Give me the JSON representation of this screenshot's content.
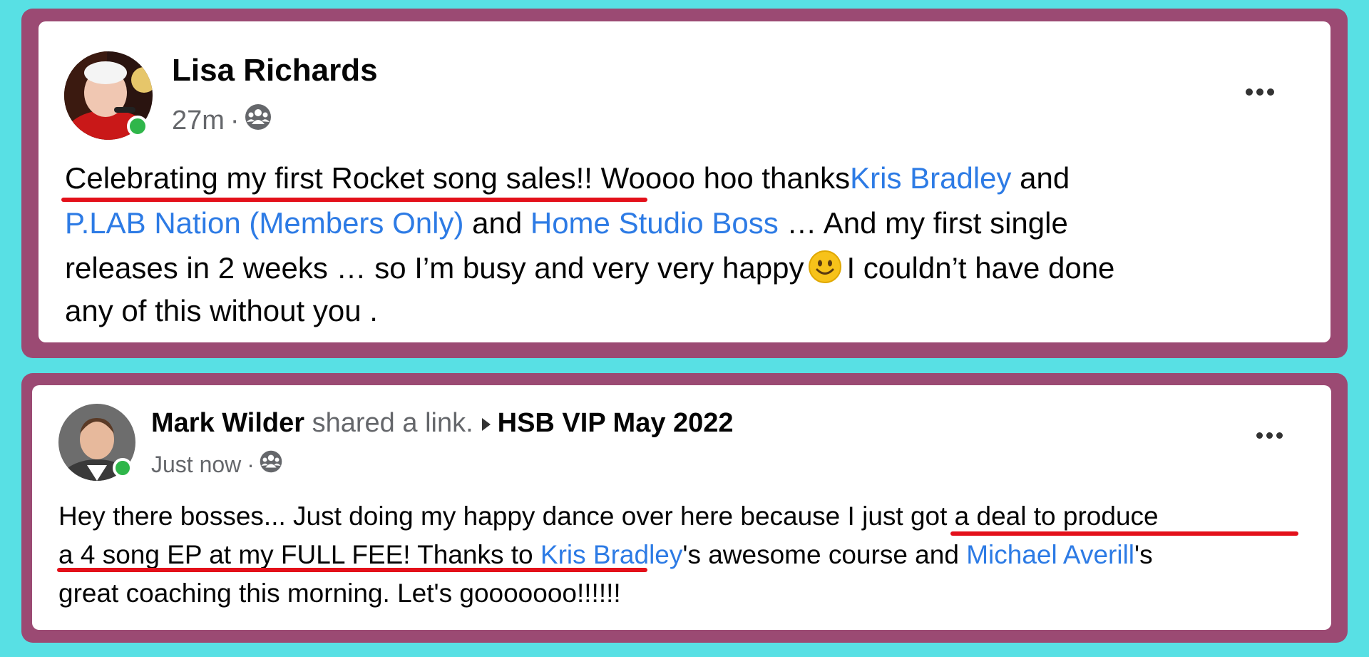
{
  "post1": {
    "author": "Lisa Richards",
    "time": "27m",
    "separator": "·",
    "audience_icon": "group-icon",
    "more_label": "More options",
    "body": {
      "l1_a": "Celebrating my first Rocket song sales",
      "l1_b": "!! Woooo hoo thanks",
      "l1_link": "Kris Bradley",
      "l1_c": " and",
      "l2_link1": "P.LAB Nation (Members Only)",
      "l2_a": " and ",
      "l2_link2": "Home Studio Boss",
      "l2_b": " … And my first single",
      "l3_a": "releases in 2 weeks … so I’m busy and very very happy",
      "l3_b": "I couldn’t have done",
      "l4": "any of this without you ."
    }
  },
  "post2": {
    "author": "Mark Wilder",
    "action": "shared a link.",
    "group": "HSB VIP May 2022",
    "time": "Just now",
    "separator": "·",
    "audience_icon": "group-icon",
    "more_label": "More options",
    "body": {
      "l1_a": "Hey there bosses... Just doing my happy dance over here because I",
      "l1_b": "just got a deal to produce",
      "l2_a": "a 4 song EP at my FULL FEE! Thanks to ",
      "l2_link1": "Kris Bradley",
      "l2_b": "'s awesome course and ",
      "l2_link2": "Michael Averill",
      "l2_c": "'s",
      "l3": "great coaching this morning.  Let's gooooooo!!!!!!"
    }
  },
  "colors": {
    "background": "#58e0e4",
    "frame": "#9b4a73",
    "link": "#2d7be5",
    "underline": "#e3101a",
    "online": "#2fb64a"
  }
}
